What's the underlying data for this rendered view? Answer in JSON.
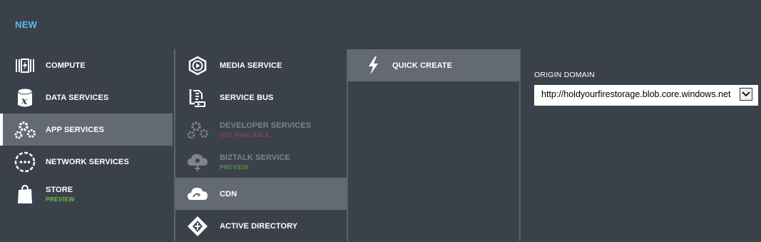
{
  "header": {
    "title": "NEW"
  },
  "categories": [
    {
      "label": "COMPUTE",
      "icon": "compute-icon"
    },
    {
      "label": "DATA SERVICES",
      "icon": "data-services-icon"
    },
    {
      "label": "APP SERVICES",
      "icon": "app-services-icon"
    },
    {
      "label": "NETWORK SERVICES",
      "icon": "network-services-icon"
    },
    {
      "label": "STORE",
      "sub": "PREVIEW",
      "icon": "store-icon"
    }
  ],
  "services": [
    {
      "label": "MEDIA SERVICE",
      "icon": "media-service-icon"
    },
    {
      "label": "SERVICE BUS",
      "icon": "service-bus-icon"
    },
    {
      "label": "DEVELOPER SERVICES",
      "sub": "NOT AVAILABLE",
      "icon": "developer-services-icon"
    },
    {
      "label": "BIZTALK SERVICE",
      "sub": "PREVIEW",
      "icon": "biztalk-service-icon"
    },
    {
      "label": "CDN",
      "icon": "cdn-icon"
    },
    {
      "label": "ACTIVE DIRECTORY",
      "icon": "active-directory-icon"
    }
  ],
  "actions": [
    {
      "label": "QUICK CREATE",
      "icon": "quick-create-icon"
    }
  ],
  "form": {
    "origin_domain_label": "ORIGIN DOMAIN",
    "origin_domain_value": "http://holdyourfirestorage.blob.core.windows.net"
  },
  "colors": {
    "background": "#3b414b",
    "selected": "#646a73",
    "title": "#5ebde6",
    "preview": "#6fbf3a",
    "not_available": "#8f3c54"
  }
}
